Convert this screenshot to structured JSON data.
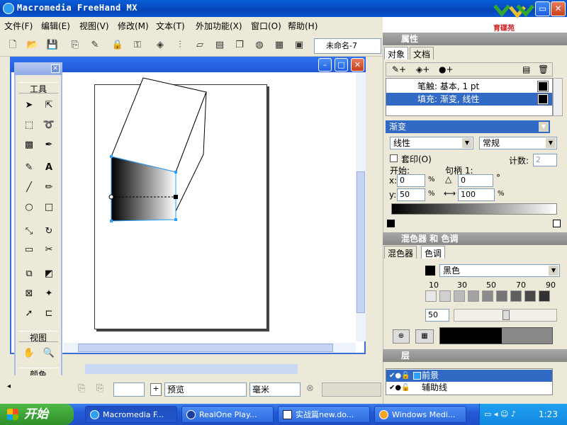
{
  "app": {
    "title": "Macromedia FreeHand MX",
    "logo_text": "育碟苑"
  },
  "menu": [
    "文件(F)",
    "编辑(E)",
    "视图(V)",
    "修改(M)",
    "文本(T)",
    "外加功能(X)",
    "窗口(O)",
    "帮助(H)"
  ],
  "toolbar": {
    "doc_name": "未命名-7"
  },
  "tools_panel": {
    "section_tools": "工具",
    "section_view": "视图",
    "section_color": "颜色"
  },
  "bottom_bar": {
    "preview": "预览",
    "units": "毫米"
  },
  "properties": {
    "header": "属性",
    "tabs": [
      "对象",
      "文档"
    ],
    "rows": [
      {
        "label": "笔触: 基本, 1 pt",
        "selected": false
      },
      {
        "label": "填充: 渐变, 线性",
        "selected": true
      }
    ],
    "fill_type": "渐变",
    "gradient_type": "线性",
    "gradient_mode": "常规",
    "overprint_label": "套印(O)",
    "count_label": "计数:",
    "count_value": "2",
    "start_label": "开始:",
    "handle_label": "句柄 1:",
    "x_label": "x:",
    "x_value": "0",
    "y_label": "y:",
    "y_value": "50",
    "percent": "%",
    "angle_value": "0",
    "degree": "°",
    "width_value": "100"
  },
  "mixer": {
    "header": "混色器 和 色调",
    "tabs": [
      "混色器",
      "色调"
    ],
    "color_name": "黑色",
    "tint_labels": [
      "10",
      "30",
      "50",
      "70",
      "90"
    ],
    "tint_value": "50",
    "tint_colors": [
      "#e8e8e8",
      "#d0d0d0",
      "#bababa",
      "#a3a3a3",
      "#8c8c8c",
      "#767676",
      "#5f5f5f",
      "#484848",
      "#323232"
    ]
  },
  "layers": {
    "header": "层",
    "rows": [
      {
        "label": "前景",
        "selected": true
      },
      {
        "label": "辅助线",
        "selected": false
      }
    ]
  },
  "taskbar": {
    "start_label": "开始",
    "tasks": [
      "Macromedia F...",
      "RealOne Play...",
      "实战篇new.do...",
      "Windows Medi..."
    ],
    "clock": "1:23"
  }
}
